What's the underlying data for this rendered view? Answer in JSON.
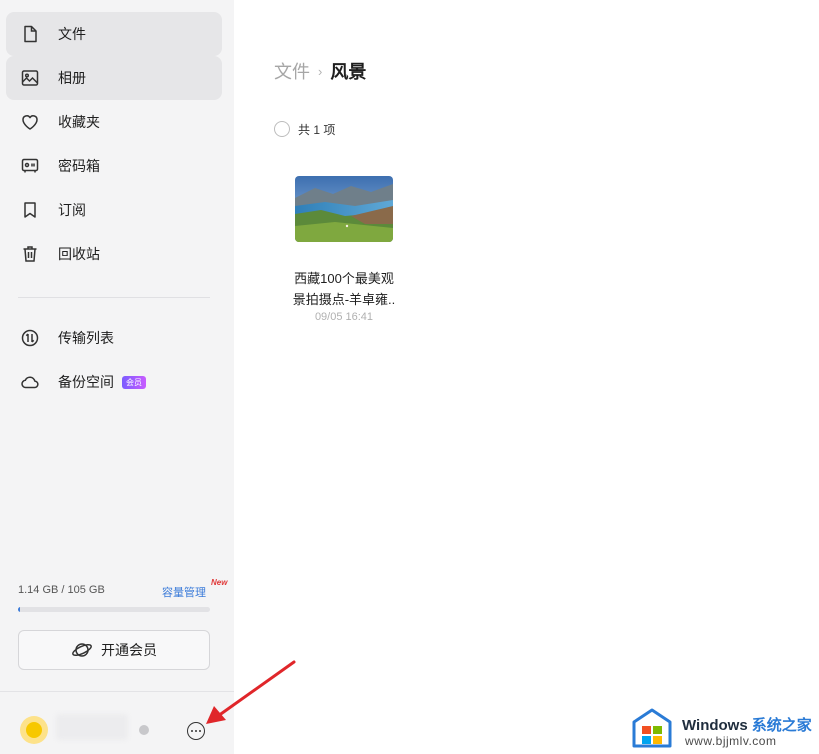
{
  "sidebar": {
    "items": [
      {
        "label": "文件",
        "icon": "file-icon",
        "active": true
      },
      {
        "label": "相册",
        "icon": "photo-icon",
        "active": true
      },
      {
        "label": "收藏夹",
        "icon": "heart-icon",
        "active": false
      },
      {
        "label": "密码箱",
        "icon": "safe-icon",
        "active": false
      },
      {
        "label": "订阅",
        "icon": "bookmark-icon",
        "active": false
      },
      {
        "label": "回收站",
        "icon": "trash-icon",
        "active": false
      }
    ],
    "secondary_items": [
      {
        "label": "传输列表",
        "icon": "transfer-icon"
      },
      {
        "label": "备份空间",
        "icon": "cloud-icon",
        "badge": "会员"
      }
    ],
    "storage": {
      "used_text": "1.14 GB / 105 GB",
      "manage_label": "容量管理",
      "new_badge": "New",
      "used_fraction": 0.011
    },
    "vip_button_label": "开通会员"
  },
  "main": {
    "breadcrumb": {
      "parent": "文件",
      "separator": "›",
      "current": "风景"
    },
    "count_text": "共 1 项",
    "files": [
      {
        "name_line1": "西藏100个最美观",
        "name_line2": "景拍摄点-羊卓雍..",
        "time": "09/05 16:41"
      }
    ]
  },
  "watermark": {
    "brand": "Windows",
    "brand_cn": "系统之家",
    "url": "www.bjjmlv.com"
  },
  "colors": {
    "sidebar_bg": "#f4f4f5",
    "active_bg": "#e6e6e8",
    "accent": "#3b7bd9",
    "arrow": "#e0262a"
  }
}
